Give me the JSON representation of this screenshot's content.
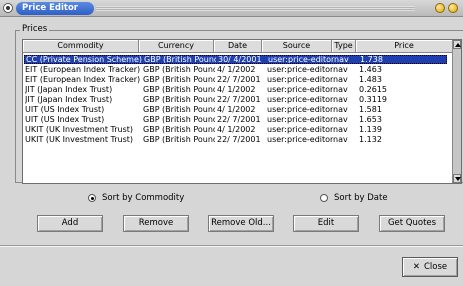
{
  "window": {
    "title": "Price Editor"
  },
  "prices_group_label": "Prices",
  "table": {
    "columns": [
      "Commodity",
      "Currency",
      "Date",
      "Source",
      "Type",
      "Price"
    ],
    "rows": [
      [
        "CC (Private Pension Scheme)",
        "GBP (British Pound)",
        "30/ 4/2001",
        "user:price-editor",
        "nav",
        "1.738"
      ],
      [
        "EIT (European Index Tracker)",
        "GBP (British Pound)",
        "4/ 1/2002",
        "user:price-editor",
        "nav",
        "1.463"
      ],
      [
        "EIT (European Index Tracker)",
        "GBP (British Pound)",
        "22/ 7/2001",
        "user:price-editor",
        "nav",
        "1.483"
      ],
      [
        "JIT (Japan Index Trust)",
        "GBP (British Pound)",
        "4/ 1/2002",
        "user:price-editor",
        "nav",
        "0.2615"
      ],
      [
        "JIT (Japan Index Trust)",
        "GBP (British Pound)",
        "22/ 7/2001",
        "user:price-editor",
        "nav",
        "0.3119"
      ],
      [
        "UIT (US Index Trust)",
        "GBP (British Pound)",
        "4/ 1/2002",
        "user:price-editor",
        "nav",
        "1.581"
      ],
      [
        "UIT (US Index Trust)",
        "GBP (British Pound)",
        "22/ 7/2001",
        "user:price-editor",
        "nav",
        "1.653"
      ],
      [
        "UKIT (UK Investment Trust)",
        "GBP (British Pound)",
        "4/ 1/2002",
        "user:price-editor",
        "nav",
        "1.139"
      ],
      [
        "UKIT (UK Investment Trust)",
        "GBP (British Pound)",
        "22/ 7/2001",
        "user:price-editor",
        "nav",
        "1.132"
      ]
    ],
    "selected_row": 0
  },
  "sort": {
    "by_commodity": "Sort by Commodity",
    "by_date": "Sort by Date",
    "selected": "commodity"
  },
  "buttons": {
    "add": "Add",
    "remove": "Remove",
    "remove_old": "Remove Old...",
    "edit": "Edit",
    "get_quotes": "Get Quotes"
  },
  "close_label": "Close"
}
